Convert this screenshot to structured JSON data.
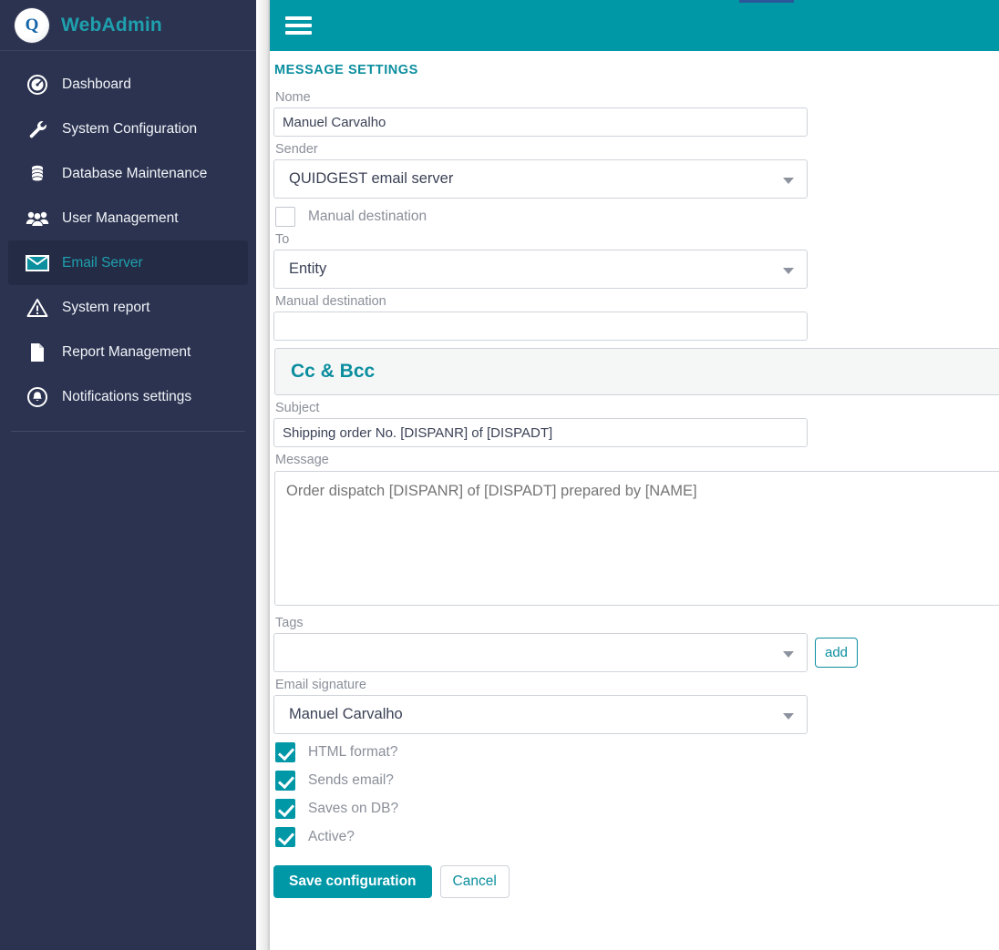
{
  "colors": {
    "sidebar_bg": "#2b3350",
    "sidebar_active_bg": "#232b45",
    "brand_teal": "#1fa0ae",
    "topbar_teal": "#0097a7",
    "accent_teal": "#0b8e9e",
    "label_grey": "#8a8f99",
    "progress_blue": "#2b579a"
  },
  "sidebar": {
    "logo_letter": "Q",
    "brand_title": "WebAdmin",
    "items": [
      {
        "label": "Dashboard",
        "icon": "dashboard-gauge-icon",
        "active": false
      },
      {
        "label": "System Configuration",
        "icon": "wrench-icon",
        "active": false
      },
      {
        "label": "Database Maintenance",
        "icon": "database-icon",
        "active": false
      },
      {
        "label": "User Management",
        "icon": "users-icon",
        "active": false
      },
      {
        "label": "Email Server",
        "icon": "envelope-icon",
        "active": true
      },
      {
        "label": "System report",
        "icon": "warning-triangle-icon",
        "active": false
      },
      {
        "label": "Report Management",
        "icon": "document-icon",
        "active": false
      },
      {
        "label": "Notifications settings",
        "icon": "bell-circle-icon",
        "active": false
      }
    ]
  },
  "topbar": {
    "menu_toggle": "hamburger-menu-icon"
  },
  "main": {
    "section_title": "MESSAGE SETTINGS",
    "name": {
      "label": "Nome",
      "value": "Manuel Carvalho",
      "placeholder": ""
    },
    "sender": {
      "label": "Sender",
      "value": "QUIDGEST email server"
    },
    "manual_destination_checkbox": {
      "label": "Manual destination",
      "checked": false
    },
    "to": {
      "label": "To",
      "value": "Entity"
    },
    "manual_destination_field": {
      "label": "Manual destination",
      "value": "",
      "placeholder": ""
    },
    "cc_bcc_panel": {
      "title": "Cc & Bcc"
    },
    "subject": {
      "label": "Subject",
      "value": "Shipping order No. [DISPANR] of [DISPADT]"
    },
    "message": {
      "label": "Message",
      "value": "",
      "placeholder": "Order dispatch [DISPANR] of [DISPADT] prepared by [NAME]"
    },
    "tags": {
      "label": "Tags",
      "value": "",
      "add_button": "add"
    },
    "email_signature": {
      "label": "Email signature",
      "value": "Manuel Carvalho"
    },
    "checkboxes": [
      {
        "label": "HTML format?",
        "checked": true
      },
      {
        "label": "Sends email?",
        "checked": true
      },
      {
        "label": "Saves on DB?",
        "checked": true
      },
      {
        "label": "Active?",
        "checked": true
      }
    ],
    "actions": {
      "save": "Save configuration",
      "cancel": "Cancel"
    }
  }
}
